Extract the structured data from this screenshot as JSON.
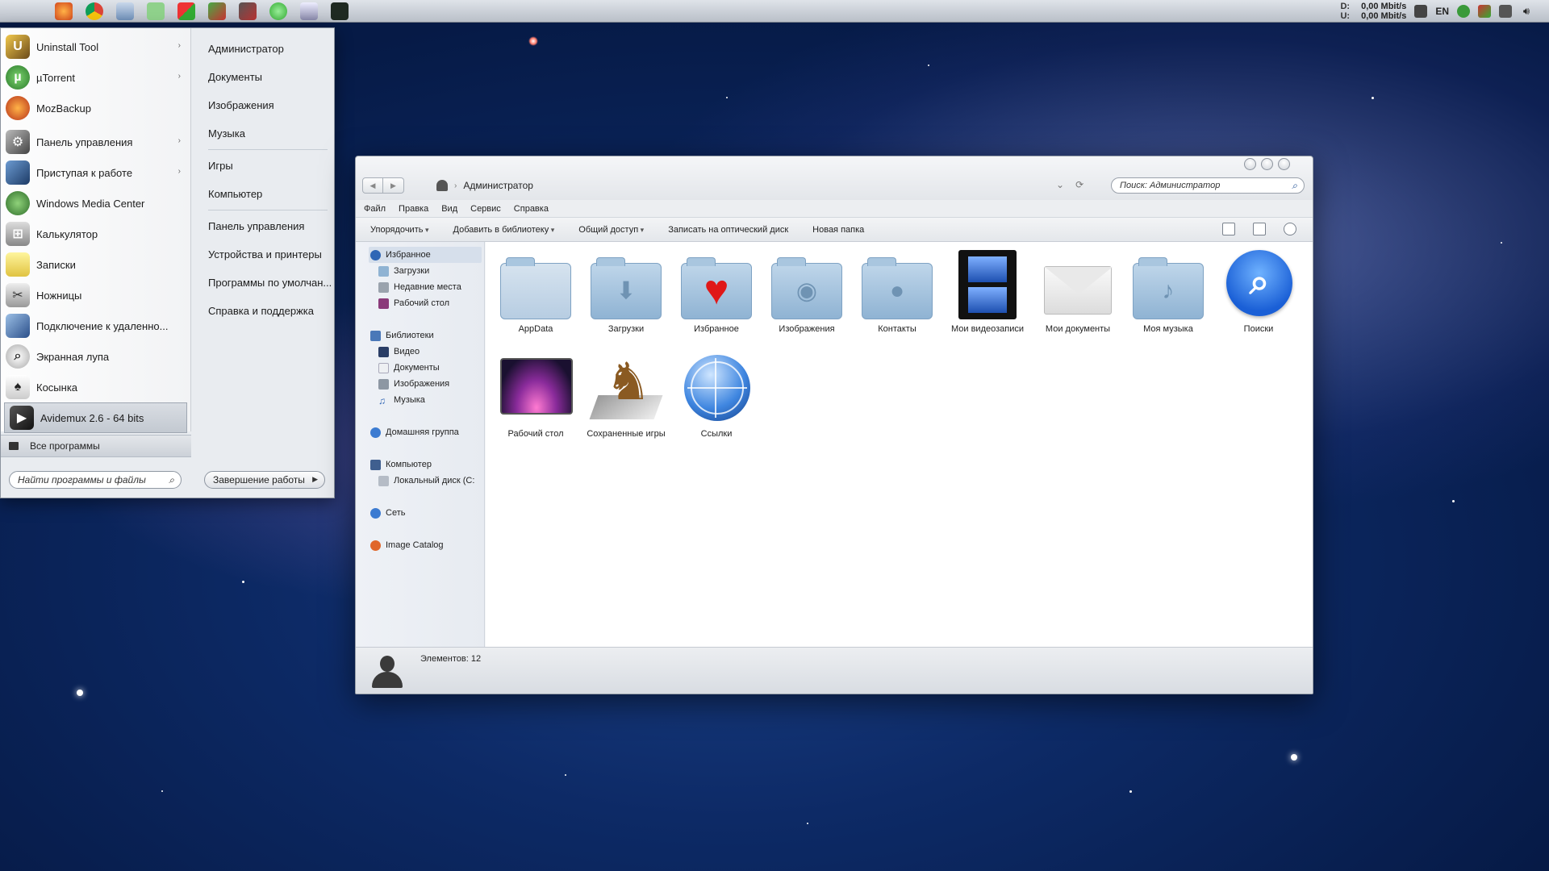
{
  "menubar": {
    "net": {
      "down_label": "D:",
      "down": "0,00 Mbit/s",
      "up_label": "U:",
      "up": "0,00 Mbit/s"
    },
    "lang": "EN"
  },
  "start_menu": {
    "programs": [
      {
        "label": "Uninstall Tool",
        "icon": "uninstall-icon",
        "arrow": true
      },
      {
        "label": "µTorrent",
        "icon": "utorrent-icon",
        "arrow": true
      },
      {
        "label": "MozBackup",
        "icon": "mozbackup-icon",
        "arrow": false
      },
      {
        "label": "Панель управления",
        "icon": "control-panel-icon",
        "arrow": true
      },
      {
        "label": "Приступая к работе",
        "icon": "getting-started-icon",
        "arrow": true
      },
      {
        "label": "Windows Media Center",
        "icon": "media-center-icon",
        "arrow": false
      },
      {
        "label": "Калькулятор",
        "icon": "calculator-icon",
        "arrow": false
      },
      {
        "label": "Записки",
        "icon": "sticky-notes-icon",
        "arrow": false
      },
      {
        "label": "Ножницы",
        "icon": "scissors-icon",
        "arrow": false
      },
      {
        "label": "Подключение к удаленно...",
        "icon": "remote-desktop-icon",
        "arrow": false
      },
      {
        "label": "Экранная лупа",
        "icon": "magnifier-icon",
        "arrow": false
      },
      {
        "label": "Косынка",
        "icon": "solitaire-icon",
        "arrow": false
      },
      {
        "label": "Avidemux 2.6 - 64 bits",
        "icon": "avidemux-icon",
        "arrow": false,
        "selected": true
      }
    ],
    "all_programs": "Все программы",
    "search_placeholder": "Найти программы и файлы",
    "shutdown": "Завершение работы",
    "places": [
      "Администратор",
      "Документы",
      "Изображения",
      "Музыка",
      "Игры",
      "Компьютер",
      "Панель управления",
      "Устройства и принтеры",
      "Программы по умолчан...",
      "Справка и поддержка"
    ]
  },
  "explorer": {
    "breadcrumb": "Администратор",
    "search_placeholder": "Поиск: Администратор",
    "menus": [
      "Файл",
      "Правка",
      "Вид",
      "Сервис",
      "Справка"
    ],
    "toolbar": {
      "organize": "Упорядочить",
      "add_library": "Добавить в библиотеку",
      "share": "Общий доступ",
      "burn": "Записать на оптический диск",
      "new_folder": "Новая папка"
    },
    "nav": {
      "favorites": "Избранное",
      "downloads": "Загрузки",
      "recent": "Недавние места",
      "desktop": "Рабочий стол",
      "libraries": "Библиотеки",
      "video": "Видео",
      "documents": "Документы",
      "images": "Изображения",
      "music": "Музыка",
      "homegroup": "Домашняя группа",
      "computer": "Компьютер",
      "local_disk": "Локальный диск (C:",
      "network": "Сеть",
      "image_catalog": "Image Catalog"
    },
    "items": [
      {
        "label": "AppData",
        "icon": "appdata-folder-icon"
      },
      {
        "label": "Загрузки",
        "icon": "downloads-folder-icon"
      },
      {
        "label": "Избранное",
        "icon": "favorites-heart-icon"
      },
      {
        "label": "Изображения",
        "icon": "pictures-folder-icon"
      },
      {
        "label": "Контакты",
        "icon": "contacts-folder-icon"
      },
      {
        "label": "Мои видеозаписи",
        "icon": "videos-film-icon"
      },
      {
        "label": "Мои документы",
        "icon": "documents-envelope-icon"
      },
      {
        "label": "Моя музыка",
        "icon": "music-folder-icon"
      },
      {
        "label": "Поиски",
        "icon": "searches-icon"
      },
      {
        "label": "Рабочий стол",
        "icon": "desktop-screen-icon"
      },
      {
        "label": "Сохраненные игры",
        "icon": "saved-games-chess-icon"
      },
      {
        "label": "Ссылки",
        "icon": "links-globe-icon"
      }
    ],
    "status": "Элементов: 12"
  }
}
